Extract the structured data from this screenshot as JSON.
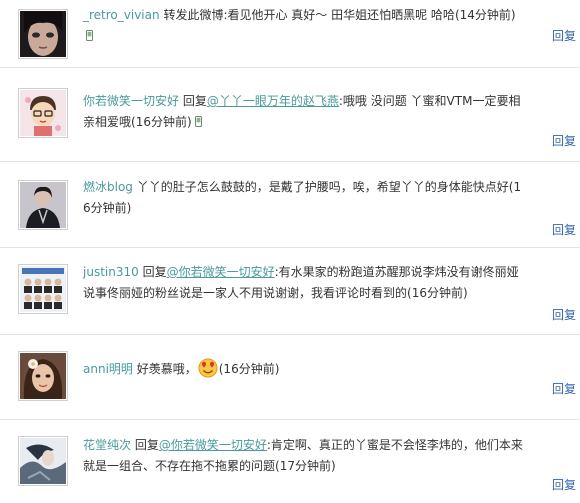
{
  "reply_label": "回复",
  "items": [
    {
      "user": "_retro_vivian",
      "pre": "",
      "mention": "",
      "text": "转发此微博:看见他开心  真好～  田华姐还怕晒黑呢  哈哈",
      "time": "(14分钟前)",
      "avatar": "dark-hair-girl-avatar"
    },
    {
      "user": "你若微笑一切安好",
      "pre": "回复",
      "mention": "@丫丫一眼万年的赵飞燕",
      "text": ":哦哦  没问题  丫蜜和VTM一定要相亲相爱哦",
      "time": "(16分钟前)",
      "avatar": "cartoon-avatar"
    },
    {
      "user": "燃冰blog",
      "pre": "",
      "mention": "",
      "text": "丫丫的肚子怎么鼓鼓的，是戴了护腰吗，唉，希望丫丫的身体能快点好",
      "time": "(16分钟前)",
      "avatar": "dark-figure-avatar"
    },
    {
      "user": "justin310",
      "pre": "回复",
      "mention": "@你若微笑一切安好",
      "text": ":有水果家的粉跑道苏醒那说李炜没有谢佟丽娅说事佟丽娅的粉丝说是一家人不用说谢谢，我看评论时看到的",
      "time": "(16分钟前)",
      "avatar": "group-photo-avatar"
    },
    {
      "user": "anni明明",
      "pre": "",
      "mention": "",
      "text": "好羡慕哦，",
      "time": "(16分钟前)",
      "avatar": "girl-with-flower-avatar",
      "emoji": "heart-eyes-emoji"
    },
    {
      "user": "花堂纯次",
      "pre": "回复",
      "mention": "@你若微笑一切安好",
      "text": ":肯定啊、真正的丫蜜是不会怪李炜的，他们本来就是一组合、不存在拖不拖累的问题",
      "time": "(17分钟前)",
      "avatar": "anime-art-avatar"
    }
  ]
}
